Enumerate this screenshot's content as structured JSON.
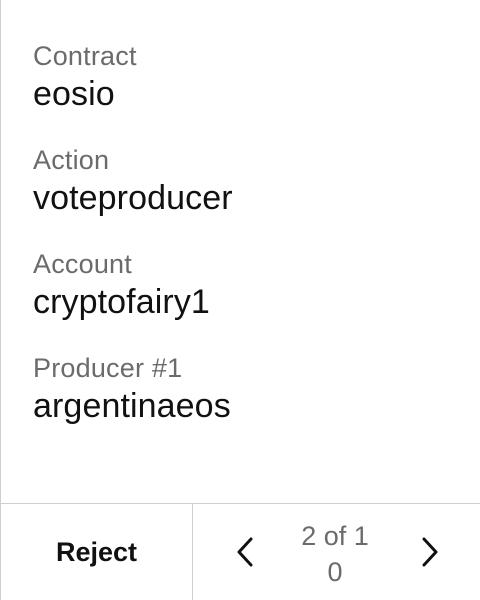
{
  "fields": [
    {
      "label": "Contract",
      "value": "eosio"
    },
    {
      "label": "Action",
      "value": "voteproducer"
    },
    {
      "label": "Account",
      "value": "cryptofairy1"
    },
    {
      "label": "Producer #1",
      "value": "argentinaeos"
    }
  ],
  "footer": {
    "reject_label": "Reject",
    "page_line1": "2 of 1",
    "page_line2": "0",
    "prev_icon": "chevron-left-icon",
    "next_icon": "chevron-right-icon"
  },
  "colors": {
    "label": "#6b6b6b",
    "value": "#111111",
    "divider": "#cfcfcf"
  }
}
